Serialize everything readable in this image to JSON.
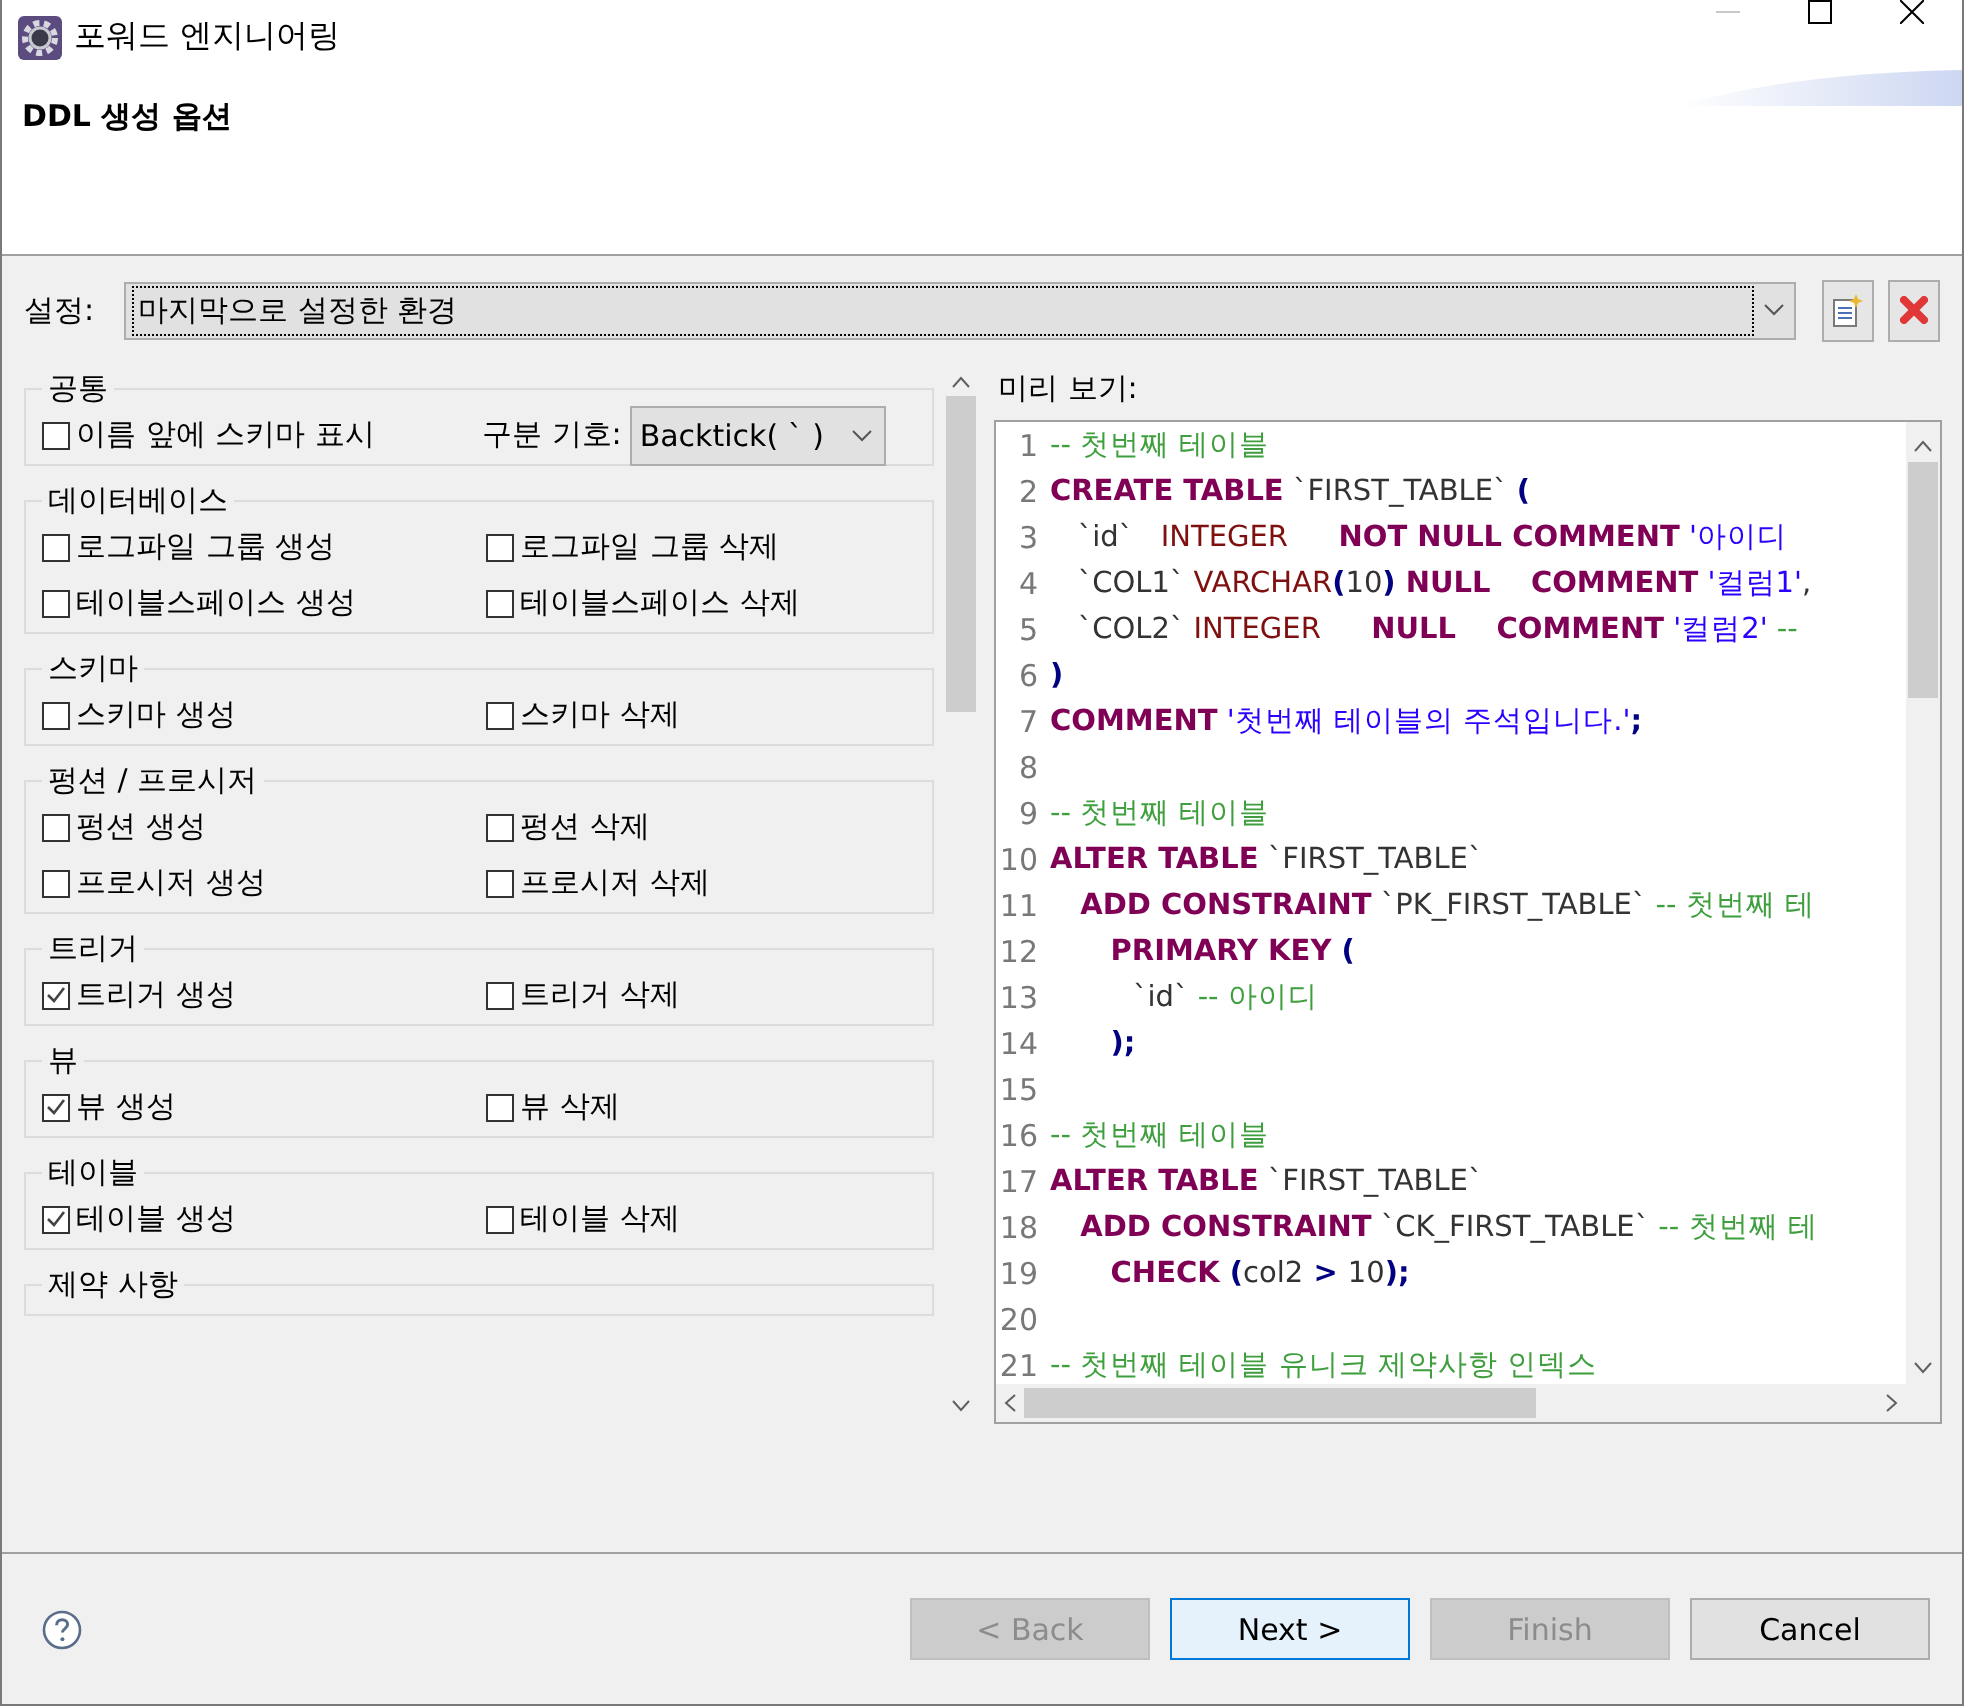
{
  "window": {
    "title": "포워드 엔지니어링"
  },
  "header": {
    "title": "DDL 생성 옵션"
  },
  "settings": {
    "label": "설정:",
    "value": "마지막으로 설정한 환경"
  },
  "option_groups": [
    {
      "title": "공통",
      "items": [
        {
          "kind": "checkbox",
          "label": "이름 앞에 스키마 표시",
          "checked": false
        },
        {
          "kind": "select",
          "label": "구분 기호:",
          "value": "Backtick( ` )"
        }
      ]
    },
    {
      "title": "데이터베이스",
      "items": [
        {
          "kind": "checkbox",
          "label": "로그파일 그룹 생성",
          "checked": false
        },
        {
          "kind": "checkbox",
          "label": "로그파일 그룹 삭제",
          "checked": false
        },
        {
          "kind": "checkbox",
          "label": "테이블스페이스 생성",
          "checked": false
        },
        {
          "kind": "checkbox",
          "label": "테이블스페이스 삭제",
          "checked": false
        }
      ]
    },
    {
      "title": "스키마",
      "items": [
        {
          "kind": "checkbox",
          "label": "스키마 생성",
          "checked": false
        },
        {
          "kind": "checkbox",
          "label": "스키마 삭제",
          "checked": false
        }
      ]
    },
    {
      "title": "펑션 / 프로시저",
      "items": [
        {
          "kind": "checkbox",
          "label": "펑션 생성",
          "checked": false
        },
        {
          "kind": "checkbox",
          "label": "펑션 삭제",
          "checked": false
        },
        {
          "kind": "checkbox",
          "label": "프로시저 생성",
          "checked": false
        },
        {
          "kind": "checkbox",
          "label": "프로시저 삭제",
          "checked": false
        }
      ]
    },
    {
      "title": "트리거",
      "items": [
        {
          "kind": "checkbox",
          "label": "트리거 생성",
          "checked": true
        },
        {
          "kind": "checkbox",
          "label": "트리거 삭제",
          "checked": false
        }
      ]
    },
    {
      "title": "뷰",
      "items": [
        {
          "kind": "checkbox",
          "label": "뷰 생성",
          "checked": true
        },
        {
          "kind": "checkbox",
          "label": "뷰 삭제",
          "checked": false
        }
      ]
    },
    {
      "title": "테이블",
      "items": [
        {
          "kind": "checkbox",
          "label": "테이블 생성",
          "checked": true
        },
        {
          "kind": "checkbox",
          "label": "테이블 삭제",
          "checked": false
        }
      ]
    },
    {
      "title": "제약 사항"
    }
  ],
  "preview": {
    "label": "미리 보기:",
    "lines": [
      {
        "number": "1",
        "tokens": [
          {
            "kind": "comment",
            "text": "-- 첫번째 테이블"
          }
        ]
      },
      {
        "number": "2",
        "tokens": [
          {
            "kind": "keyword",
            "text": "CREATE TABLE"
          },
          {
            "kind": "plain",
            "text": " `FIRST_TABLE` "
          },
          {
            "kind": "punct",
            "text": "("
          }
        ]
      },
      {
        "number": "3",
        "tokens": [
          {
            "kind": "plain",
            "text": "   `id`   "
          },
          {
            "kind": "type",
            "text": "INTEGER"
          },
          {
            "kind": "keyword",
            "text": "     NOT NULL COMMENT"
          },
          {
            "kind": "string",
            "text": " '아이디"
          }
        ]
      },
      {
        "number": "4",
        "tokens": [
          {
            "kind": "plain",
            "text": "   `COL1` "
          },
          {
            "kind": "type",
            "text": "VARCHAR"
          },
          {
            "kind": "punct",
            "text": "("
          },
          {
            "kind": "plain",
            "text": "10"
          },
          {
            "kind": "punct",
            "text": ")"
          },
          {
            "kind": "keyword",
            "text": " NULL    COMMENT"
          },
          {
            "kind": "string",
            "text": " '컬럼1'"
          },
          {
            "kind": "plain",
            "text": ","
          }
        ]
      },
      {
        "number": "5",
        "tokens": [
          {
            "kind": "plain",
            "text": "   `COL2` "
          },
          {
            "kind": "type",
            "text": "INTEGER"
          },
          {
            "kind": "keyword",
            "text": "     NULL    COMMENT"
          },
          {
            "kind": "string",
            "text": " '컬럼2'"
          },
          {
            "kind": "comment",
            "text": " --"
          }
        ]
      },
      {
        "number": "6",
        "tokens": [
          {
            "kind": "punct",
            "text": ")"
          }
        ]
      },
      {
        "number": "7",
        "tokens": [
          {
            "kind": "keyword",
            "text": "COMMENT"
          },
          {
            "kind": "string",
            "text": " '첫번째 테이블의 주석입니다.'"
          },
          {
            "kind": "punct",
            "text": ";"
          }
        ]
      },
      {
        "number": "8"
      },
      {
        "number": "9",
        "tokens": [
          {
            "kind": "comment",
            "text": "-- 첫번째 테이블"
          }
        ]
      },
      {
        "number": "10",
        "tokens": [
          {
            "kind": "keyword",
            "text": "ALTER TABLE"
          },
          {
            "kind": "plain",
            "text": " `FIRST_TABLE`"
          }
        ]
      },
      {
        "number": "11",
        "tokens": [
          {
            "kind": "keyword",
            "text": "   ADD CONSTRAINT"
          },
          {
            "kind": "plain",
            "text": " `PK_FIRST_TABLE`"
          },
          {
            "kind": "comment",
            "text": " -- 첫번째 테"
          }
        ]
      },
      {
        "number": "12",
        "tokens": [
          {
            "kind": "keyword",
            "text": "      PRIMARY KEY"
          },
          {
            "kind": "punct",
            "text": " ("
          }
        ]
      },
      {
        "number": "13",
        "tokens": [
          {
            "kind": "plain",
            "text": "         `id`"
          },
          {
            "kind": "comment",
            "text": " -- 아이디"
          }
        ]
      },
      {
        "number": "14",
        "tokens": [
          {
            "kind": "punct",
            "text": "      );"
          }
        ]
      },
      {
        "number": "15"
      },
      {
        "number": "16",
        "tokens": [
          {
            "kind": "comment",
            "text": "-- 첫번째 테이블"
          }
        ]
      },
      {
        "number": "17",
        "tokens": [
          {
            "kind": "keyword",
            "text": "ALTER TABLE"
          },
          {
            "kind": "plain",
            "text": " `FIRST_TABLE`"
          }
        ]
      },
      {
        "number": "18",
        "tokens": [
          {
            "kind": "keyword",
            "text": "   ADD CONSTRAINT"
          },
          {
            "kind": "plain",
            "text": " `CK_FIRST_TABLE`"
          },
          {
            "kind": "comment",
            "text": " -- 첫번째 테"
          }
        ]
      },
      {
        "number": "19",
        "tokens": [
          {
            "kind": "keyword",
            "text": "      CHECK"
          },
          {
            "kind": "punct",
            "text": " ("
          },
          {
            "kind": "plain",
            "text": "col2"
          },
          {
            "kind": "punct",
            "text": " > "
          },
          {
            "kind": "plain",
            "text": "10"
          },
          {
            "kind": "punct",
            "text": ");"
          }
        ]
      },
      {
        "number": "20"
      },
      {
        "number": "21",
        "tokens": [
          {
            "kind": "comment",
            "text": "-- 첫번째 테이블 유니크 제약사항 인덱스"
          }
        ]
      }
    ]
  },
  "buttons": [
    {
      "label": "< Back",
      "disabled": true,
      "default": false
    },
    {
      "label": "Next >",
      "disabled": false,
      "default": true
    },
    {
      "label": "Finish",
      "disabled": true,
      "default": false
    },
    {
      "label": "Cancel",
      "disabled": false,
      "default": false
    }
  ]
}
